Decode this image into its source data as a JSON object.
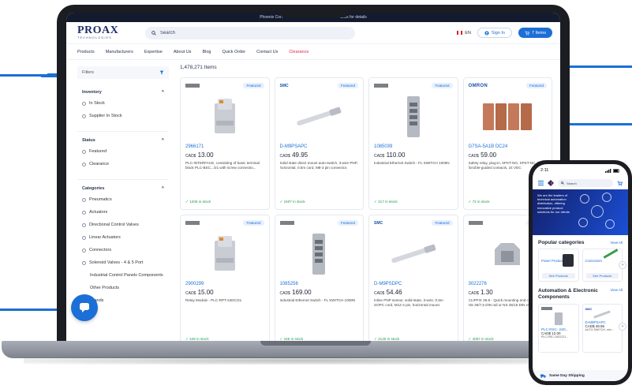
{
  "colors": {
    "accent": "#1b6fd6",
    "brand_navy": "#1d2d6b",
    "clearance": "#e0294a",
    "in_stock": "#1f9a4a"
  },
  "promo": {
    "left": "Phoenix Con",
    "right": "- Click for details"
  },
  "header": {
    "logo_main": "PROAX",
    "logo_sub": "TECHNOLOGIES",
    "search_placeholder": "Search",
    "lang": "EN",
    "signin": "Sign In",
    "items": "7 Items"
  },
  "nav": [
    "Products",
    "Manufacturers",
    "Expertise",
    "About Us",
    "Blog",
    "Quick Order",
    "Contact Us",
    "Clearance"
  ],
  "sidebar": {
    "filters_label": "Filters",
    "groups": [
      {
        "title": "Inventory",
        "options": [
          "In Stock",
          "Supplier In Stock"
        ]
      },
      {
        "title": "Status",
        "options": [
          "Featured",
          "Clearance"
        ]
      },
      {
        "title": "Categories",
        "options": [
          "Pneumatics",
          "Actuators",
          "Directional Control Valves",
          "Linear Actuators",
          "Connectors",
          "Solenoid Valves - 4 & 5 Port",
          "Industrial Control Panels Components",
          "Other Products",
          "Brands"
        ]
      }
    ]
  },
  "results": {
    "count": "1,478,271 Items"
  },
  "products": [
    {
      "brand": "phoenix",
      "badge": "Featured",
      "pn": "2966171",
      "currency": "CAD$",
      "price": "13.00",
      "desc": "PLC-INTERFACE, consisting of basic terminal block PLC-BSC.../21 with screw connectio...",
      "stock": "✓ 1206 in stock",
      "img": "relay"
    },
    {
      "brand": "smc",
      "brand_text": "SMC",
      "badge": "Featured",
      "pn": "D-M9PSAPC",
      "currency": "CAD$",
      "price": "49.95",
      "desc": "Solid state direct mount auto-switch, 3-wire PNP, horizontal, 0.5m cord, M8-3 pin connector.",
      "stock": "✓ 1507 in stock",
      "img": "sensor"
    },
    {
      "brand": "phoenix",
      "badge": "Featured",
      "pn": "1085039",
      "currency": "CAD$",
      "price": "110.00",
      "desc": "Industrial Ethernet Switch - FL SWITCH 1005N",
      "stock": "✓ 217 in stock",
      "img": "switch"
    },
    {
      "brand": "omron",
      "brand_text": "OMRON",
      "badge": "Featured",
      "pn": "G7SA-5A1B DC24",
      "currency": "CAD$",
      "price": "59.00",
      "desc": "Safety relay, plug-in, 5PST-NO, SPST-NC, 6 A, forcible-guided contacts, 24 VDC",
      "stock": "✓ 72 in stock",
      "img": "relays"
    },
    {
      "brand": "phoenix",
      "badge": "Featured",
      "pn": "2900299",
      "currency": "CAD$",
      "price": "15.00",
      "desc": "Relay Module - PLC-RPT-24DC/21",
      "stock": "✓ 446 in stock",
      "img": "relay"
    },
    {
      "brand": "phoenix",
      "badge": "Featured",
      "pn": "1085256",
      "currency": "CAD$",
      "price": "169.00",
      "desc": "Industrial Ethernet Switch - FL SWITCH 1008N",
      "stock": "✓ 165 in stock",
      "img": "switch"
    },
    {
      "brand": "smc",
      "brand_text": "SMC",
      "badge": "Featured",
      "pn": "D-M9PSDPC",
      "currency": "CAD$",
      "price": "54.46",
      "desc": "Inline PNP sensor, solid-state, 3-wire, 0.5m SOPC cord, M12-4 pin, horizontal mount.",
      "stock": "✓ 2125 in stock",
      "img": "sensor"
    },
    {
      "brand": "phoenix",
      "badge": "Featured",
      "pn": "3022276",
      "currency": "CAD$",
      "price": "1.30",
      "desc": "CLIPFIX 35-5 - Quick mounting end clamp for NS 35/7,5 DIN rail or NS 35/15 DIN rail, with...",
      "stock": "✓ 4067 in stock",
      "img": "clamp"
    }
  ],
  "phone": {
    "time": "2:11",
    "search_placeholder": "Search",
    "hero_text": "We are the leaders of technical automation distribution, offering innovative product solutions for our clients",
    "popular_title": "Popular categories",
    "view_all": "View All",
    "cat1_label": "Power Products",
    "cat1_btn": "See Products",
    "cat2_label": "Connectors",
    "cat2_btn": "See Products",
    "auto_title": "Automation & Electronic Components",
    "prod1_pn": "PLC-RSC- 24D...",
    "prod1_price": "CAD$ 12.00",
    "prod1_desc": "PLC-RSC-24DC/21...",
    "prod2_pn": "D-M9PSAPC",
    "prod2_price": "CAD$ 49.95",
    "prod2_desc": "AUTO-SWITCH, min...",
    "footer": "Same Day Shipping"
  }
}
